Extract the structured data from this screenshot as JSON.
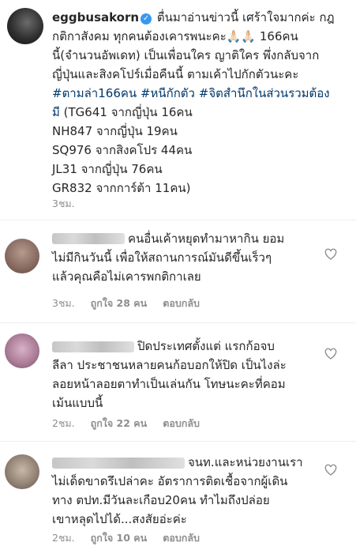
{
  "post": {
    "username": "eggbusakorn",
    "caption_lines": [
      "ตื่นมาอ่านข่าวนี้ เศร้าใจมากค่ะ กฎ",
      "กติกาสังคม ทุกคนต้องเคารพนะคะ🙏🏻🙏🏻 166คน",
      "นี้(จำนวนอัพเดท) เป็นเพื่อนใคร ญาติใคร พึ่งกลับจาก",
      "ญี่ปุ่นและสิงคโปร์เมื่อคืนนี้ ตามเค้าไปกักตัวนะคะ"
    ],
    "hashtags": [
      "#ตามล่า166คน",
      "#หนีกักตัว",
      "#จิตสำนึกในส่วนรวมต้อง",
      "มี"
    ],
    "flights": [
      "(TG641 จากญี่ปุ่น 16คน",
      "NH847 จากญี่ปุ่น 19คน",
      "SQ976 จากสิงคโปร 44คน",
      "JL31 จากญี่ปุ่น 76คน",
      "GR832 จากการ์ต้า 11คน)"
    ],
    "time": "3ชม."
  },
  "comments": [
    {
      "lines": [
        "คนอื่นเค้าหยุดทำมาหากิน ยอม",
        "ไม่มีกินวันนี้ เพื่อให้สถานการณ์มันดีขึ้นเร็วๆ",
        "แล้วคุณคือไม่เคารพกติกาเลย"
      ],
      "time": "3ชม.",
      "likes": "ถูกใจ 28 คน",
      "reply": "ตอบกลับ"
    },
    {
      "lines": [
        "ปิดประเทศตั้งแต่ แรกก้อจบ",
        "ลีลา ประชาชนหลายคนก้อบอกให้ปิด เป็นไงล่ะ",
        "ลอยหน้าลอยตาทำเป็นเล่นกัน โทษนะคะที่คอม",
        "เม้นแบบนี้"
      ],
      "time": "2ชม.",
      "likes": "ถูกใจ 22 คน",
      "reply": "ตอบกลับ"
    },
    {
      "lines": [
        "จนท.และหน่วยงานเรา",
        "ไม่เด็ดขาดรึเปล่าคะ อัตราการติดเชื้อจากผู้เดิน",
        "ทาง ตปท.มีวันละเกือบ20คน ทำไมถึงปล่อย",
        "เขาหลุดไปได้...สงสัยอ่ะค่ะ"
      ],
      "time": "2ชม.",
      "likes": "ถูกใจ 10 คน",
      "reply": "ตอบกลับ"
    }
  ],
  "colors": {
    "hashtag": "#00376b",
    "verified": "#3897f0",
    "meta_text": "#8e8e8e"
  }
}
